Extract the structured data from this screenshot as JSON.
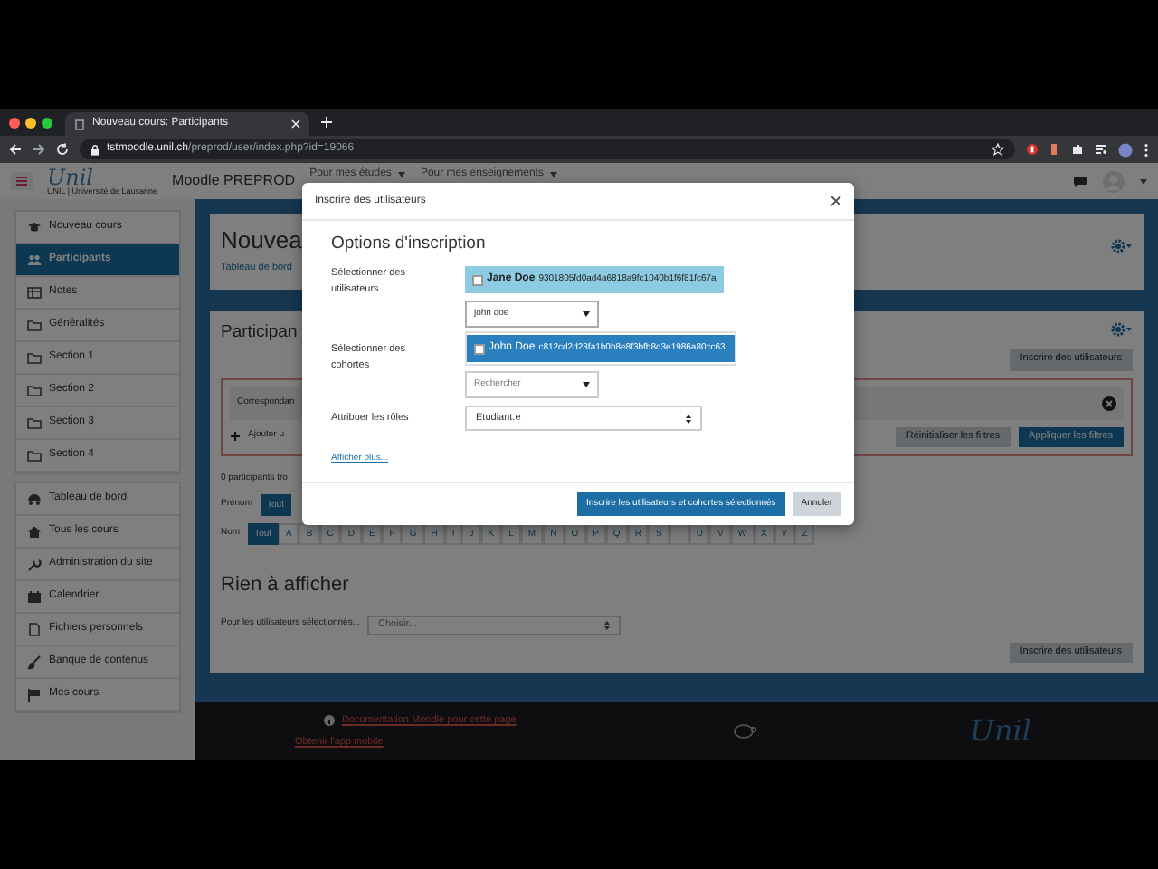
{
  "browser": {
    "tab_title": "Nouveau cours: Participants",
    "url": "**tstmoodle.unil.ch**/preprod/user/index.php?id=19066"
  },
  "navbar": {
    "logo_text": "Unil",
    "logo_subtitle": "UNIL | Université de Lausanne",
    "site_name": "Moodle PREPROD",
    "menus": [
      "Pour mes études",
      "Pour mes enseignements"
    ]
  },
  "sidebar": {
    "groups": [
      {
        "items": [
          {
            "label": "Nouveau cours",
            "selected": false
          },
          {
            "label": "Participants",
            "selected": true
          },
          {
            "label": "Notes",
            "selected": false
          },
          {
            "label": "Généralités",
            "selected": false
          },
          {
            "label": "Section 1",
            "selected": false
          },
          {
            "label": "Section 2",
            "selected": false
          },
          {
            "label": "Section 3",
            "selected": false
          },
          {
            "label": "Section 4",
            "selected": false
          }
        ]
      },
      {
        "items": [
          {
            "label": "Tableau de bord",
            "selected": false
          },
          {
            "label": "Tous les cours",
            "selected": false
          },
          {
            "label": "Administration du site",
            "selected": false
          },
          {
            "label": "Calendrier",
            "selected": false
          },
          {
            "label": "Fichiers personnels",
            "selected": false
          },
          {
            "label": "Banque de contenus",
            "selected": false
          },
          {
            "label": "Mes cours",
            "selected": false
          }
        ]
      }
    ]
  },
  "page": {
    "title": "Nouvea",
    "breadcrumb": "Tableau de bord",
    "section_title": "Participan",
    "enrol_button_top": "Inscrire des utilisateurs",
    "filter": {
      "match_label": "Correspondan",
      "add_label": "Ajouter u",
      "reset": "Réinitialiser les filtres",
      "apply": "Appliquer les filtres"
    },
    "count_text": "0 participants tro",
    "firstname_filter": {
      "label": "Prénom",
      "letters": [
        {
          "label": "Tout",
          "selected": true
        }
      ]
    },
    "lastname_filter": {
      "label": "Nom",
      "letters": [
        {
          "label": "Tout",
          "selected": true
        },
        {
          "label": "A",
          "selected": false
        },
        {
          "label": "B",
          "selected": false
        },
        {
          "label": "C",
          "selected": false
        },
        {
          "label": "D",
          "selected": false
        },
        {
          "label": "E",
          "selected": false
        },
        {
          "label": "F",
          "selected": false
        },
        {
          "label": "G",
          "selected": false
        },
        {
          "label": "H",
          "selected": false
        },
        {
          "label": "I",
          "selected": false
        },
        {
          "label": "J",
          "selected": false
        },
        {
          "label": "K",
          "selected": false
        },
        {
          "label": "L",
          "selected": false
        },
        {
          "label": "M",
          "selected": false
        },
        {
          "label": "N",
          "selected": false
        },
        {
          "label": "O",
          "selected": false
        },
        {
          "label": "P",
          "selected": false
        },
        {
          "label": "Q",
          "selected": false
        },
        {
          "label": "R",
          "selected": false
        },
        {
          "label": "S",
          "selected": false
        },
        {
          "label": "T",
          "selected": false
        },
        {
          "label": "U",
          "selected": false
        },
        {
          "label": "V",
          "selected": false
        },
        {
          "label": "W",
          "selected": false
        },
        {
          "label": "X",
          "selected": false
        },
        {
          "label": "Y",
          "selected": false
        },
        {
          "label": "Z",
          "selected": false
        }
      ]
    },
    "empty_title": "Rien à afficher",
    "bulk": {
      "label": "Pour les utilisateurs sélectionnés...",
      "placeholder": "Choisir..."
    },
    "enrol_button_bottom": "Inscrire des utilisateurs"
  },
  "footer": {
    "doc_link": "Documentation Moodle pour cette page",
    "app_link": "Obtenir l'app mobile",
    "logo_text": "Unil"
  },
  "modal": {
    "title": "Inscrire des utilisateurs",
    "heading": "Options d'inscription",
    "users_label": "Sélectionner des utilisateurs",
    "selected_users": [
      {
        "name": "Jane Doe",
        "hash": "9301805fd0ad4a6818a9fc1040b1f6f81fc67a"
      }
    ],
    "search_value": "john doe",
    "suggestions": [
      {
        "name": "John Doe",
        "hash": "c812cd2d23fa1b0b8e8f3bfb8d3e1986a80cc63",
        "selected": true
      }
    ],
    "cohorts_label": "Sélectionner des cohortes",
    "cohorts_placeholder": "Rechercher",
    "roles_label": "Attribuer les rôles",
    "role_value": "Etudiant.e",
    "more_link": "Afficher plus...",
    "submit": "Inscrire les utilisateurs et cohortes sélectionnés",
    "cancel": "Annuler"
  }
}
